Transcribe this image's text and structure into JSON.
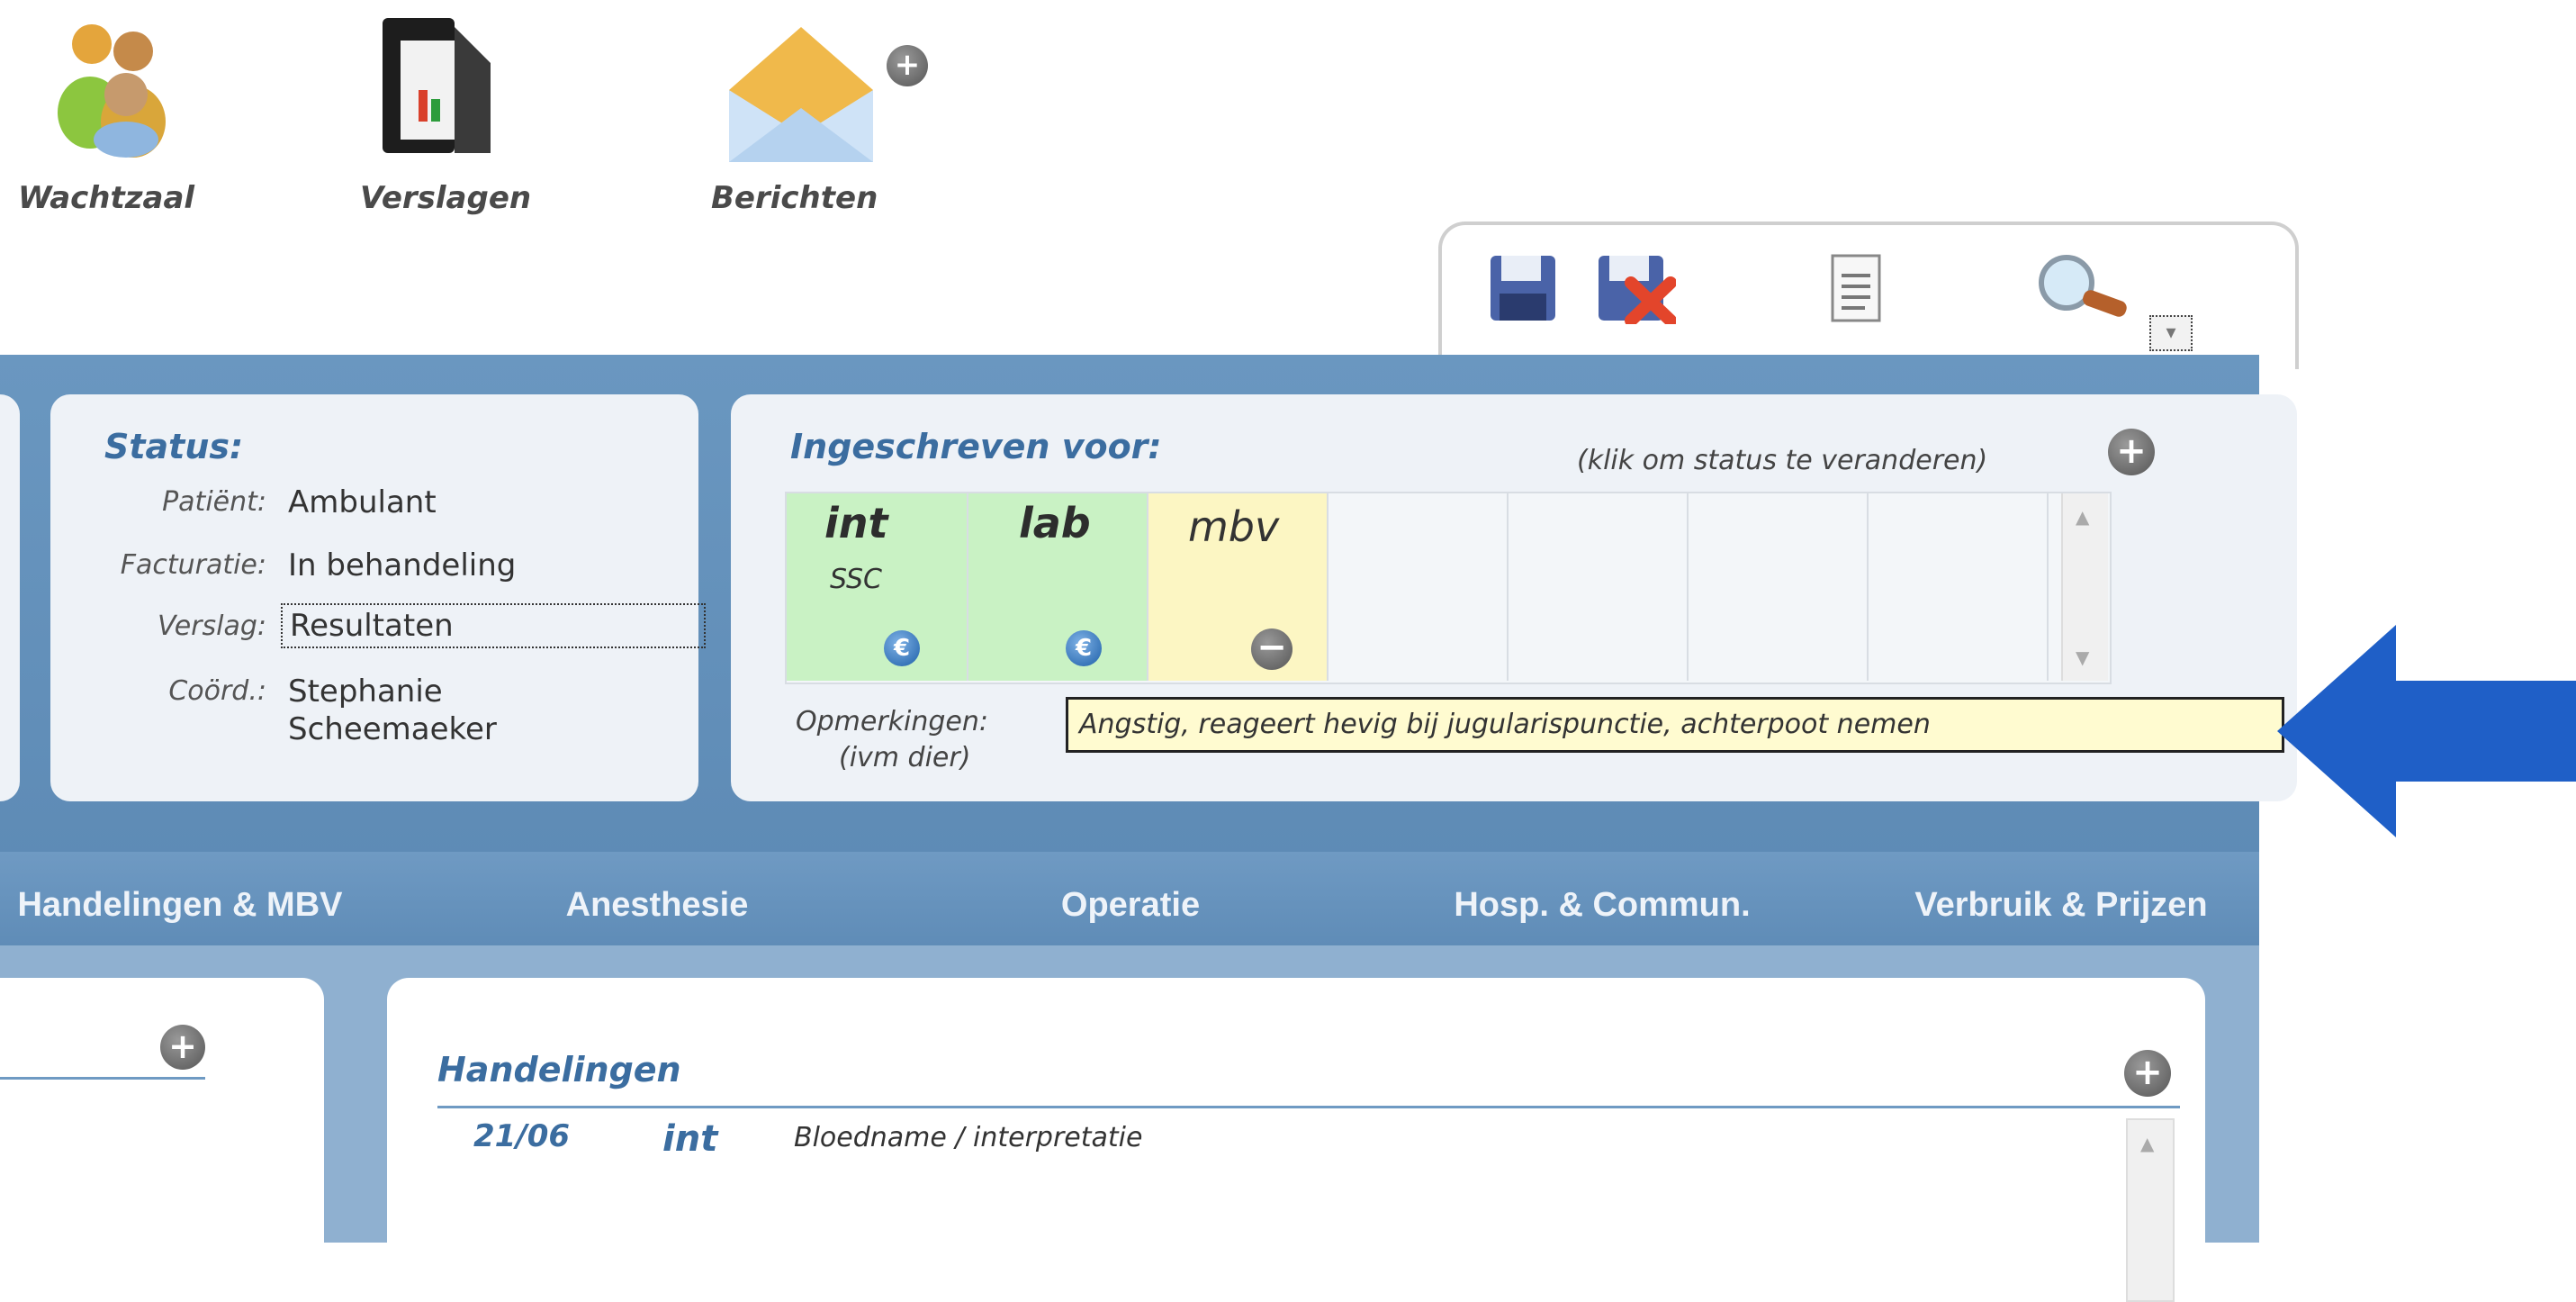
{
  "toolbar": {
    "items": [
      {
        "label": "Wachtzaal",
        "icon": "waiting-room-icon"
      },
      {
        "label": "Verslagen",
        "icon": "reports-folder-icon"
      },
      {
        "label": "Berichten",
        "icon": "messages-envelope-icon"
      }
    ],
    "actions": [
      "save-icon",
      "discard-icon",
      "document-icon",
      "search-icon"
    ]
  },
  "status": {
    "title": "Status:",
    "rows": [
      {
        "label": "Patiënt:",
        "value": "Ambulant"
      },
      {
        "label": "Facturatie:",
        "value": "In behandeling"
      },
      {
        "label": "Verslag:",
        "value": "Resultaten"
      },
      {
        "label": "Coörd.:",
        "value": "Stephanie",
        "value2": "Scheemaeker"
      }
    ]
  },
  "registration": {
    "title": "Ingeschreven voor:",
    "hint": "(klik om status te veranderen)",
    "departments": [
      {
        "code": "int",
        "sub": "SSC",
        "color": "#c9f2c4",
        "badge": "euro"
      },
      {
        "code": "lab",
        "sub": "",
        "color": "#c9f2c4",
        "badge": "euro"
      },
      {
        "code": "mbv",
        "sub": "",
        "color": "#fcf6c3",
        "badge": "minus"
      }
    ],
    "remarks_label": "Opmerkingen:",
    "remarks_sub": "(ivm dier)",
    "remarks": "Angstig, reageert hevig bij jugularispunctie, achterpoot nemen"
  },
  "tabs": [
    "Handelingen & MBV",
    "Anesthesie",
    "Operatie",
    "Hosp. & Commun.",
    "Verbruik & Prijzen"
  ],
  "handelingen": {
    "title": "Handelingen",
    "rows": [
      {
        "date": "21/06",
        "dept": "int",
        "description": "Bloedname / interpretatie"
      }
    ]
  },
  "colors": {
    "band": "#5f8cb7",
    "panel": "#eef2f7",
    "title_blue": "#3b6da0",
    "arrow": "#1f5fc7",
    "remarks_bg": "#fffbd0"
  }
}
